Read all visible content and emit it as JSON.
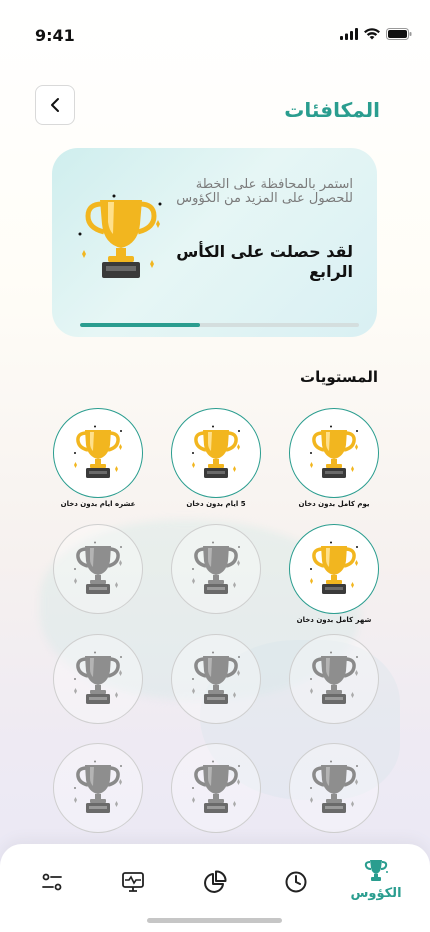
{
  "status_bar": {
    "time": "9:41"
  },
  "header": {
    "title": "المكافئات",
    "back_icon": "chevron-left-icon"
  },
  "hero": {
    "subtitle": "استمر بالمحافظة على الخطة للحصول على المزيد من الكؤوس",
    "title": "لقد حصلت على الكأس الرابع",
    "progress": 0.43
  },
  "levels": {
    "title": "المستويات",
    "items": [
      {
        "label": "يوم كامل بدون دخان",
        "earned": true
      },
      {
        "label": "5 ايام بدون دخان",
        "earned": true
      },
      {
        "label": "عشره ايام بدون دخان",
        "earned": true
      },
      {
        "label": "شهر كامل بدون دخان",
        "earned": true
      },
      {
        "label": "",
        "earned": false
      },
      {
        "label": "",
        "earned": false
      },
      {
        "label": "",
        "earned": false
      },
      {
        "label": "",
        "earned": false
      },
      {
        "label": "",
        "earned": false
      },
      {
        "label": "",
        "earned": false
      },
      {
        "label": "",
        "earned": false
      },
      {
        "label": "",
        "earned": false
      }
    ]
  },
  "nav": {
    "active_label": "الكؤوس",
    "items": [
      "trophy-icon",
      "clock-icon",
      "pie-chart-icon",
      "monitor-pulse-icon",
      "sliders-icon"
    ]
  },
  "colors": {
    "accent": "#2a9d8f",
    "gold": "#f2b61f"
  }
}
